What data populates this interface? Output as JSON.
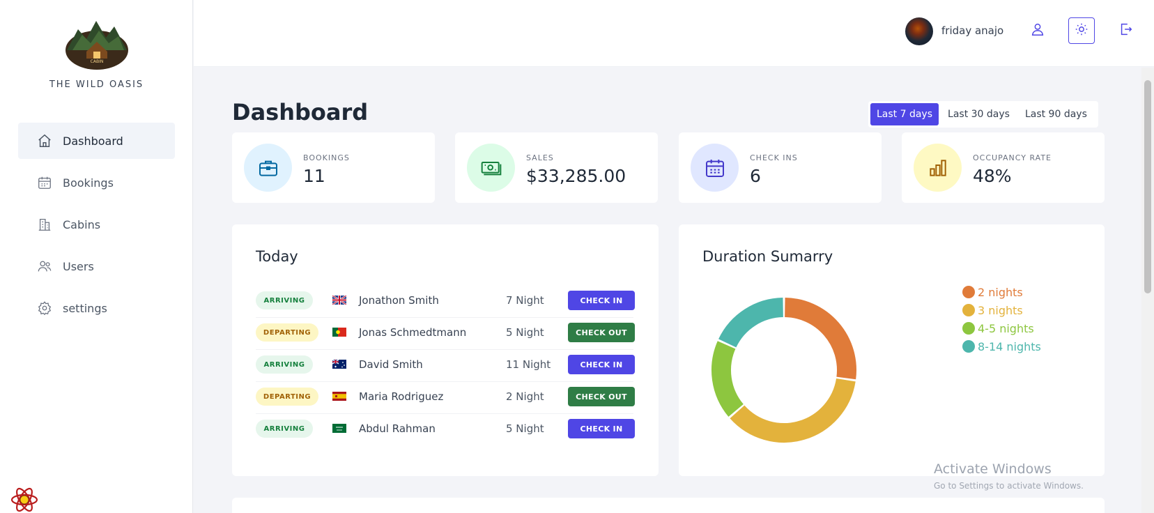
{
  "brand": {
    "name": "THE WILD OASIS",
    "logo_text": "CABIN"
  },
  "sidebar": {
    "items": [
      {
        "label": "Dashboard",
        "icon": "home-icon",
        "active": true
      },
      {
        "label": "Bookings",
        "icon": "calendar-icon",
        "active": false
      },
      {
        "label": "Cabins",
        "icon": "building-icon",
        "active": false
      },
      {
        "label": "Users",
        "icon": "users-icon",
        "active": false
      },
      {
        "label": "settings",
        "icon": "gear-icon",
        "active": false
      }
    ]
  },
  "header": {
    "username": "friday anajo",
    "icons": [
      "user-icon",
      "sun-icon",
      "logout-icon"
    ]
  },
  "page": {
    "title": "Dashboard",
    "filters": [
      {
        "label": "Last 7 days",
        "active": true
      },
      {
        "label": "Last 30 days",
        "active": false
      },
      {
        "label": "Last 90 days",
        "active": false
      }
    ]
  },
  "stats": [
    {
      "label": "BOOKINGS",
      "value": "11",
      "icon": "briefcase-icon",
      "bg": "#e0f2fe",
      "fg": "#0369a1"
    },
    {
      "label": "SALES",
      "value": "$33,285.00",
      "icon": "banknotes-icon",
      "bg": "#dcfce7",
      "fg": "#15803d"
    },
    {
      "label": "CHECK INS",
      "value": "6",
      "icon": "calendar-days-icon",
      "bg": "#e0e7ff",
      "fg": "#4338ca"
    },
    {
      "label": "OCCUPANCY RATE",
      "value": "48%",
      "icon": "chart-bar-icon",
      "bg": "#fef9c3",
      "fg": "#a16207"
    }
  ],
  "today": {
    "title": "Today",
    "rows": [
      {
        "status": "ARRIVING",
        "flag": "gb",
        "guest": "Jonathon Smith",
        "nights": "7 Night",
        "action": "CHECK IN"
      },
      {
        "status": "DEPARTING",
        "flag": "pt",
        "guest": "Jonas Schmedtmann",
        "nights": "5 Night",
        "action": "CHECK OUT"
      },
      {
        "status": "ARRIVING",
        "flag": "au",
        "guest": "David Smith",
        "nights": "11 Night",
        "action": "CHECK IN"
      },
      {
        "status": "DEPARTING",
        "flag": "es",
        "guest": "Maria Rodriguez",
        "nights": "2 Night",
        "action": "CHECK OUT"
      },
      {
        "status": "ARRIVING",
        "flag": "sa",
        "guest": "Abdul Rahman",
        "nights": "5 Night",
        "action": "CHECK IN"
      }
    ]
  },
  "duration": {
    "title": "Duration Sumarry",
    "legend": [
      {
        "label": "2 nights",
        "color": "#e07b39"
      },
      {
        "label": "3 nights",
        "color": "#e3b23c"
      },
      {
        "label": "4-5 nights",
        "color": "#8dc63f"
      },
      {
        "label": "8-14 nights",
        "color": "#4db6ac"
      }
    ]
  },
  "chart_data": {
    "type": "pie",
    "title": "Duration Sumarry",
    "categories": [
      "2 nights",
      "3 nights",
      "4-5 nights",
      "8-14 nights"
    ],
    "values": [
      3,
      4,
      2,
      2
    ],
    "colors": [
      "#e07b39",
      "#e3b23c",
      "#8dc63f",
      "#4db6ac"
    ],
    "donut": true,
    "legend": "right"
  },
  "watermark": {
    "line1": "Activate Windows",
    "line2": "Go to Settings to activate Windows."
  }
}
